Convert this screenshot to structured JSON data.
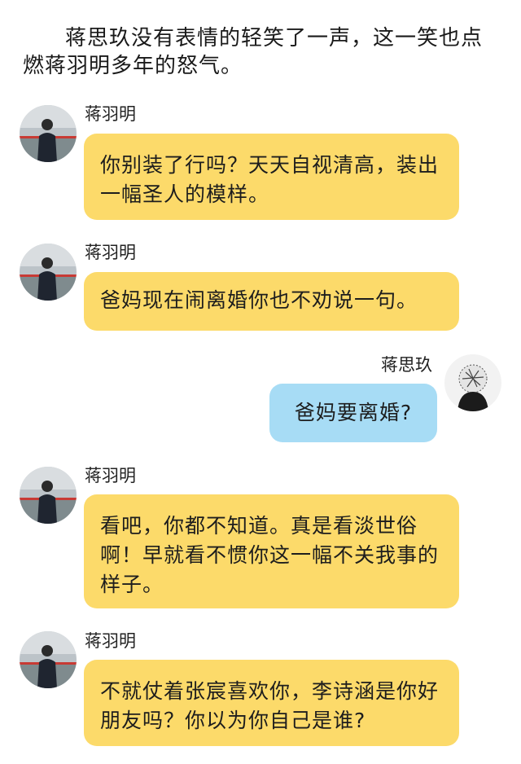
{
  "narration": "蒋思玖没有表情的轻笑了一声，这一笑也点燃蒋羽明多年的怒气。",
  "messages": [
    {
      "speaker": "蒋羽明",
      "side": "left",
      "text": "你别装了行吗？天天自视清高，装出一幅圣人的模样。",
      "bubble_color": "#fcda6a"
    },
    {
      "speaker": "蒋羽明",
      "side": "left",
      "text": "爸妈现在闹离婚你也不劝说一句。",
      "bubble_color": "#fcda6a"
    },
    {
      "speaker": "蒋思玖",
      "side": "right",
      "text": "爸妈要离婚?",
      "bubble_color": "#a7dcf5"
    },
    {
      "speaker": "蒋羽明",
      "side": "left",
      "text": "看吧，你都不知道。真是看淡世俗啊！早就看不惯你这一幅不关我事的样子。",
      "bubble_color": "#fcda6a"
    },
    {
      "speaker": "蒋羽明",
      "side": "left",
      "text": "不就仗着张宸喜欢你，李诗涵是你好朋友吗？你以为你自己是谁?",
      "bubble_color": "#fcda6a"
    }
  ]
}
